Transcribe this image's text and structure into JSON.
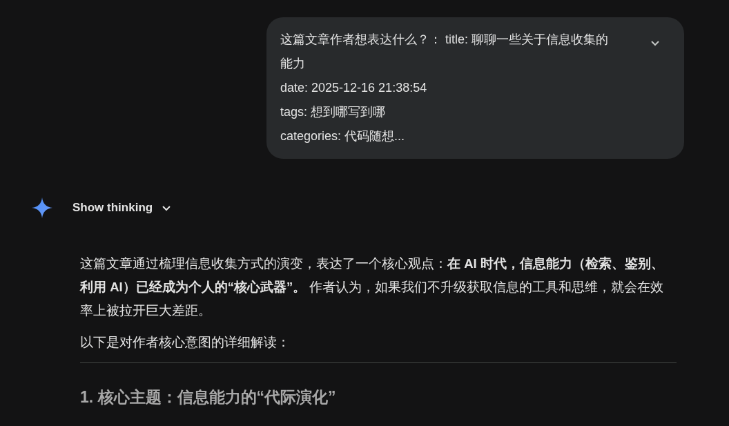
{
  "user_message": {
    "lines": [
      "这篇文章作者想表达什么？： title: 聊聊一些关于信息收集的能力",
      "date: 2025-12-16 21:38:54",
      "tags: 想到哪写到哪",
      "categories: 代码随想..."
    ],
    "expanded": false
  },
  "response": {
    "thinking": {
      "label": "Show thinking",
      "expanded": false
    },
    "paragraphs": [
      "这篇文章通过梳理信息收集方式的演变，表达了一个核心观点：**在 AI 时代，信息能力（检索、鉴别、利用 AI）已经成为个人的“核心武器”。** 作者认为，如果我们不升级获取信息的工具和思维，就会在效率上被拉开巨大差距。",
      "以下是对作者核心意图的详细解读："
    ],
    "heading": "1. 核心主题：信息能力的“代际演化”"
  }
}
